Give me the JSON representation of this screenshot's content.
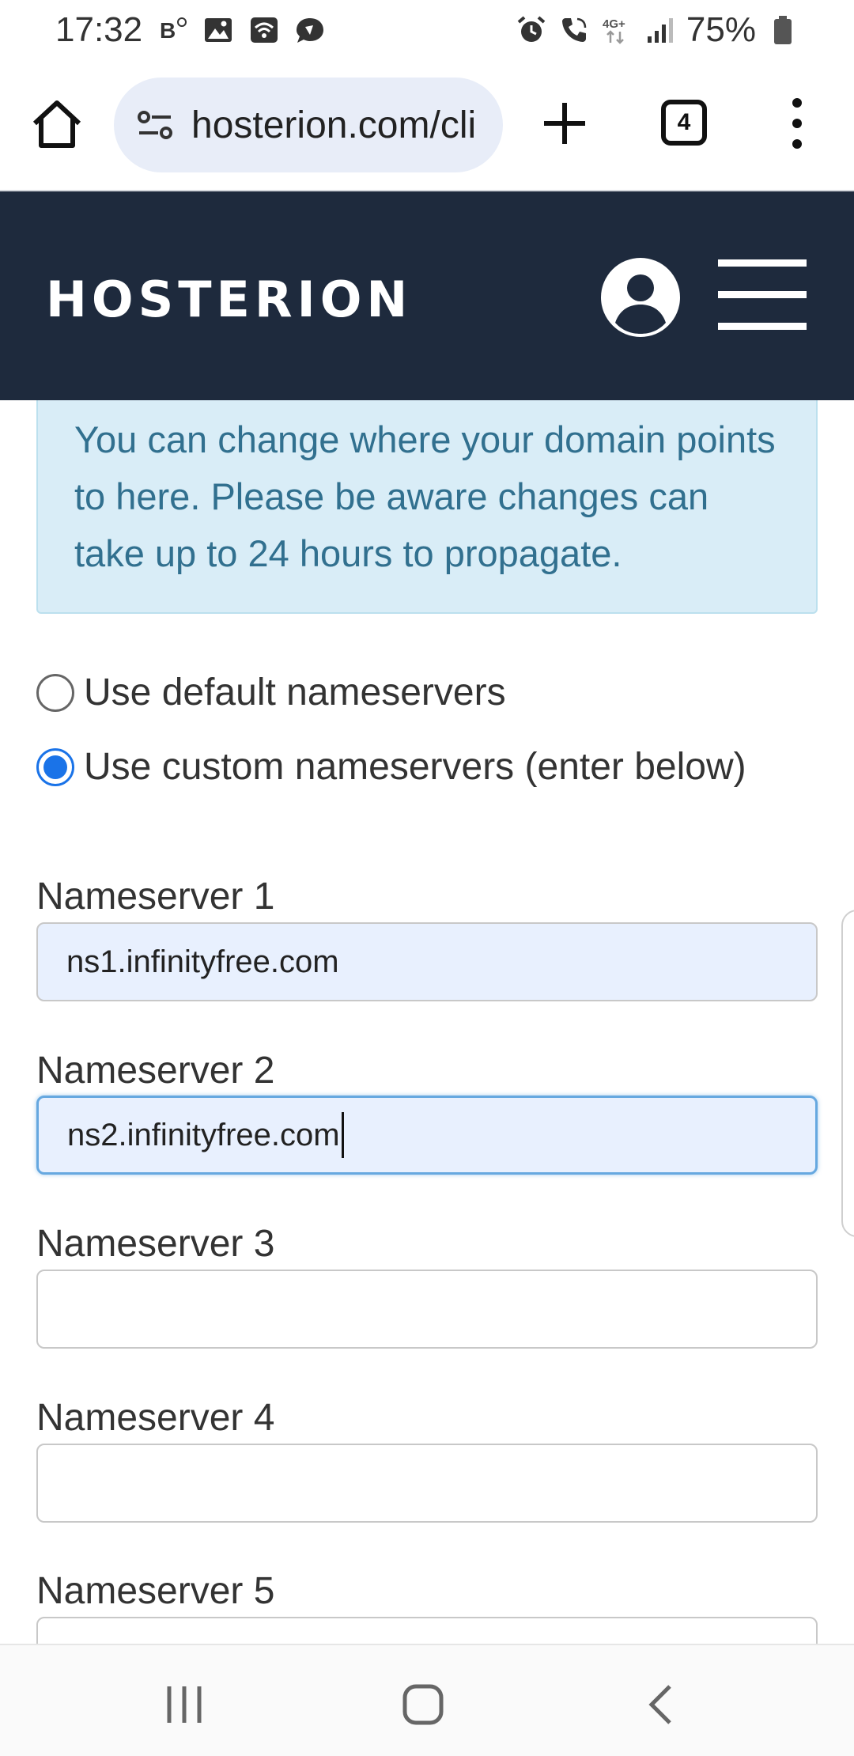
{
  "status_bar": {
    "time": "17:32",
    "battery": "75%",
    "network": "4G+"
  },
  "browser": {
    "url": "hosterion.com/cli",
    "tab_count": "4"
  },
  "site": {
    "logo": "HOSTERION"
  },
  "alert": {
    "text": "You can change where your domain points to here. Please be aware changes can take up to 24 hours to propagate."
  },
  "nameserver_options": {
    "default_label": "Use default nameservers",
    "custom_label": "Use custom nameservers (enter below)",
    "selected": "custom"
  },
  "nameservers": [
    {
      "label": "Nameserver 1",
      "value": "ns1.infinityfree.com"
    },
    {
      "label": "Nameserver 2",
      "value": "ns2.infinityfree.com"
    },
    {
      "label": "Nameserver 3",
      "value": ""
    },
    {
      "label": "Nameserver 4",
      "value": ""
    },
    {
      "label": "Nameserver 5",
      "value": ""
    }
  ],
  "colors": {
    "header_bg": "#1e2a3d",
    "alert_bg": "#d9edf7",
    "alert_text": "#31708f",
    "accent": "#1a73e8"
  }
}
